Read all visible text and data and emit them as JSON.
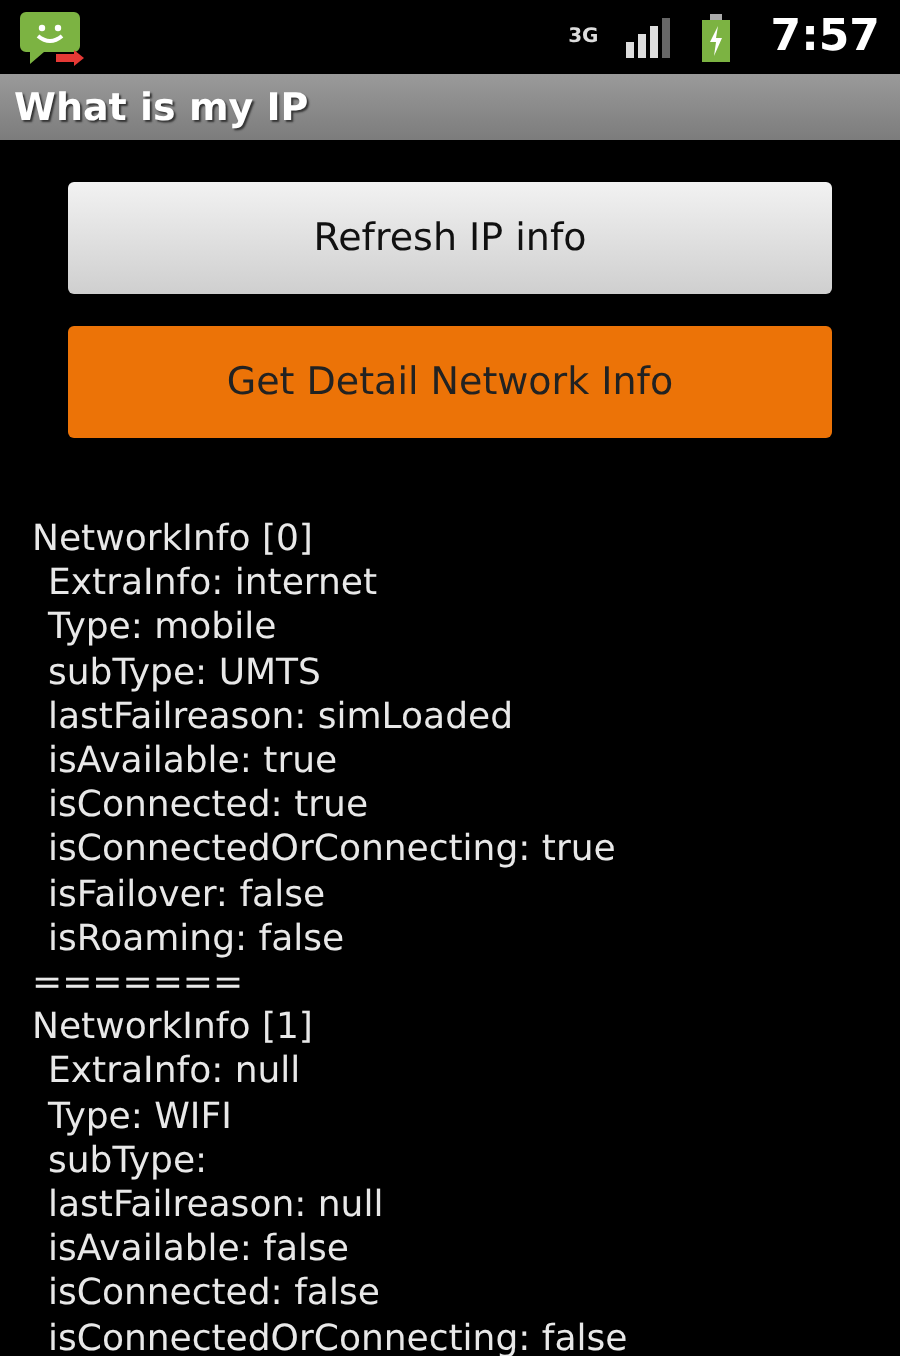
{
  "status_bar": {
    "network": "3G",
    "time": "7:57"
  },
  "app_bar": {
    "title": "What is my IP"
  },
  "buttons": [
    {
      "label": "Refresh IP info",
      "kind": "secondary"
    },
    {
      "label": "Get Detail Network Info",
      "kind": "primary"
    }
  ],
  "info_lines": [
    {
      "kind": "header",
      "text": "NetworkInfo [0]"
    },
    {
      "kind": "field",
      "text": "ExtraInfo: internet"
    },
    {
      "kind": "field",
      "text": "Type: mobile"
    },
    {
      "kind": "field",
      "text": "subType: UMTS"
    },
    {
      "kind": "field",
      "text": "lastFailreason: simLoaded"
    },
    {
      "kind": "field",
      "text": "isAvailable: true"
    },
    {
      "kind": "field",
      "text": "isConnected: true"
    },
    {
      "kind": "field",
      "text": "isConnectedOrConnecting: true"
    },
    {
      "kind": "field",
      "text": "isFailover: false"
    },
    {
      "kind": "field",
      "text": "isRoaming: false"
    },
    {
      "kind": "separator",
      "text": "======="
    },
    {
      "kind": "header",
      "text": "NetworkInfo [1]"
    },
    {
      "kind": "field",
      "text": "ExtraInfo: null"
    },
    {
      "kind": "field",
      "text": "Type: WIFI"
    },
    {
      "kind": "field",
      "text": "subType:"
    },
    {
      "kind": "field",
      "text": "lastFailreason: null"
    },
    {
      "kind": "field",
      "text": "isAvailable: false"
    },
    {
      "kind": "field",
      "text": "isConnected: false"
    },
    {
      "kind": "field",
      "text": "isConnectedOrConnecting: false"
    }
  ]
}
